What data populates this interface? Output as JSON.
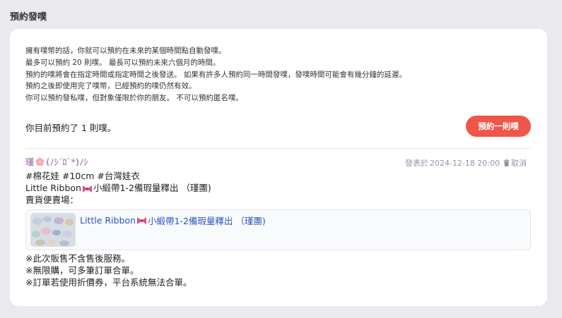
{
  "section": {
    "title": "預約發噗"
  },
  "info": {
    "lines": [
      "擁有噗幣的話，你就可以預約在未來的某個時間點自動發噗。",
      "最多可以預約 20 則噗。 最長可以預約未來六個月的時間。",
      "預約的噗將會在指定時間或指定時間之後發送。 如果有許多人預約同一時間發噗，發噗時間可能會有幾分鐘的延遲。",
      "預約之後即使用完了噗幣，已經預約的噗仍然有效。",
      "你可以預約發私噗，但對象僅限於你的朋友。 不可以預約匿名噗。"
    ]
  },
  "status": {
    "text": "你目前預約了 1 則噗。"
  },
  "actions": {
    "schedule_button": "預約一則噗"
  },
  "post": {
    "author": "瑾",
    "author_suffix": "(ﾉｼ´ﾛ`*)ﾉｼ",
    "meta_prefix": "發表於",
    "datetime": "2024-12-18 20:00",
    "cancel_label": "取消",
    "body": {
      "line1": "#棉花娃 #10cm #台灣娃衣",
      "line2_a": "Little Ribbon",
      "line2_b": "小緞帶1-2備瑕量釋出 （瑾團)",
      "line3": "賣貨便賣場："
    },
    "link_card": {
      "title_a": "Little Ribbon",
      "title_b": "小緞帶1-2備瑕量釋出 （瑾團)"
    },
    "footer": [
      "※此次販售不含售後服務。",
      "※無限購，可多筆訂單合單。",
      "※訂單若使用折價券，平台系統無法合單。"
    ]
  },
  "colors": {
    "accent": "#f0554a",
    "author": "#b58bc0",
    "link": "#2a55c0",
    "meta": "#8f96a8"
  },
  "icons": {
    "author_decoration": "flower-icon",
    "emoji": "ribbon-icon",
    "cancel": "trash-icon"
  }
}
